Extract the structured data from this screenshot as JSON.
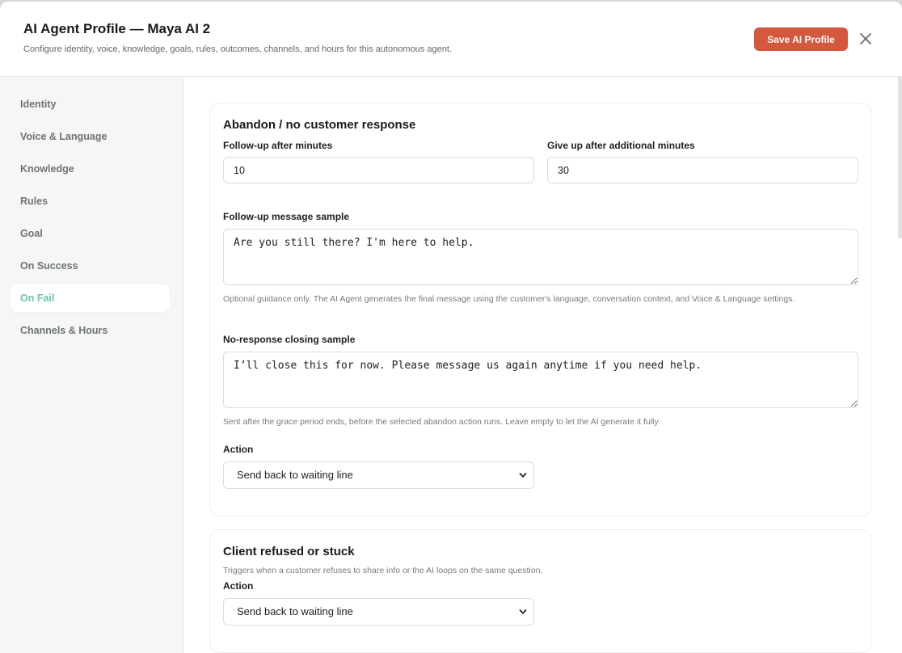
{
  "header": {
    "title": "AI Agent Profile — Maya AI 2",
    "subtitle": "Configure identity, voice, knowledge, goals, rules, outcomes, channels, and hours for this autonomous agent.",
    "save_label": "Save AI Profile",
    "close_icon": "close-icon"
  },
  "sidebar": {
    "items": [
      {
        "label": "Identity",
        "active": false
      },
      {
        "label": "Voice & Language",
        "active": false
      },
      {
        "label": "Knowledge",
        "active": false
      },
      {
        "label": "Rules",
        "active": false
      },
      {
        "label": "Goal",
        "active": false
      },
      {
        "label": "On Success",
        "active": false
      },
      {
        "label": "On Fail",
        "active": true
      },
      {
        "label": "Channels & Hours",
        "active": false
      }
    ]
  },
  "abandon": {
    "title": "Abandon / no customer response",
    "followup_label": "Follow-up after minutes",
    "followup_value": "10",
    "giveup_label": "Give up after additional minutes",
    "giveup_value": "30",
    "followup_msg_label": "Follow-up message sample",
    "followup_msg_value": "Are you still there? I'm here to help.",
    "followup_msg_help": "Optional guidance only. The AI Agent generates the final message using the customer's language, conversation context, and Voice & Language settings.",
    "closing_label": "No-response closing sample",
    "closing_value": "I’ll close this for now. Please message us again anytime if you need help.",
    "closing_help": "Sent after the grace period ends, before the selected abandon action runs. Leave empty to let the AI generate it fully.",
    "action_label": "Action",
    "action_value": "Send back to waiting line"
  },
  "refused": {
    "title": "Client refused or stuck",
    "description": "Triggers when a customer refuses to share info or the AI loops on the same question.",
    "action_label": "Action",
    "action_value": "Send back to waiting line"
  },
  "colors": {
    "accent": "#d4583d",
    "active_nav": "#6dc4ad",
    "sidebar_bg": "#f6f6f4"
  }
}
